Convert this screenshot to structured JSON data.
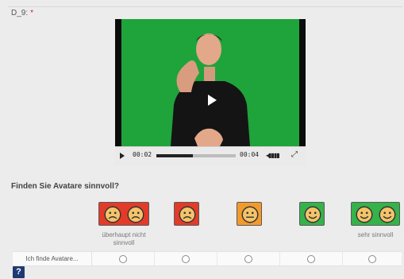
{
  "question": {
    "id": "D_9:",
    "required_marker": "*",
    "text": "Finden Sie Avatare sinnvoll?"
  },
  "video": {
    "current_time": "00:02",
    "duration": "00:04",
    "progress_fraction": 0.46,
    "background_color": "#1fa33b"
  },
  "scale": {
    "anchor_low": "überhaupt nicht sinnvoll",
    "anchor_high": "sehr sinnvoll",
    "row_label": "Ich finde Avatare..."
  },
  "colors": {
    "very_negative": "#e23b2a",
    "neutral": "#f39a2c",
    "positive": "#36b24a",
    "help": "#1e3a72"
  },
  "help": {
    "label": "?"
  }
}
